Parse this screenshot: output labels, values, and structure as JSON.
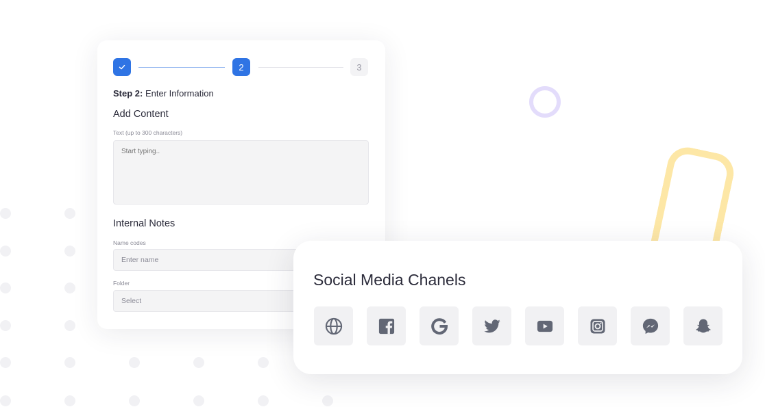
{
  "stepper": {
    "steps": [
      {
        "label": "",
        "state": "completed",
        "icon": "check-icon"
      },
      {
        "label": "2",
        "state": "current"
      },
      {
        "label": "3",
        "state": "upcoming"
      }
    ],
    "accent_color": "#2f74e4"
  },
  "form": {
    "step_heading_bold": "Step 2:",
    "step_heading_text": " Enter Information",
    "add_content_title": "Add Content",
    "text_label": "Text (up to 300 characters)",
    "text_placeholder": "Start typing..",
    "internal_notes_title": "Internal Notes",
    "name_codes_label": "Name codes",
    "name_codes_placeholder": "Enter name",
    "folder_label": "Folder",
    "folder_value": "Select"
  },
  "social": {
    "title": "Social Media Chanels",
    "icons": [
      "globe-icon",
      "facebook-icon",
      "google-icon",
      "twitter-icon",
      "youtube-icon",
      "instagram-icon",
      "messenger-icon",
      "snapchat-icon"
    ],
    "icon_color": "#626775"
  }
}
